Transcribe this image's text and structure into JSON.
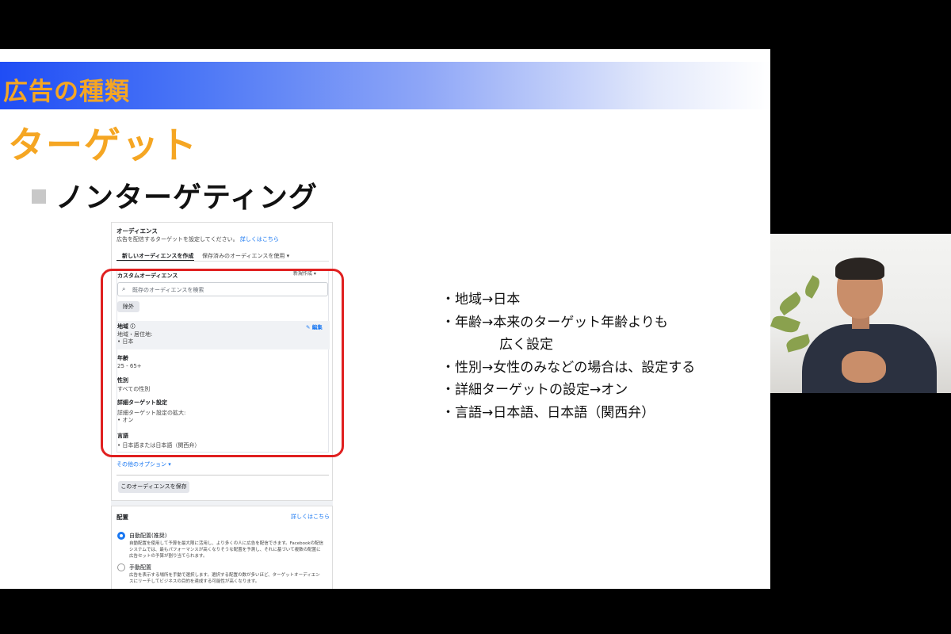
{
  "slide": {
    "band_title": "広告の種類",
    "heading": "ターゲット",
    "subheading": "ノンターゲティング",
    "notes": [
      "・地域→日本",
      "・年齢→本来のターゲット年齢よりも",
      "広く設定",
      "・性別→女性のみなどの場合は、設定する",
      "・詳細ターゲットの設定→オン",
      "・言語→日本語、日本語（関西弁）"
    ]
  },
  "screenshot": {
    "audience_title": "オーディエンス",
    "audience_desc": "広告を配信するターゲットを設定してください。",
    "learn_more": "詳しくはこちら",
    "tab_new": "新しいオーディエンスを作成",
    "tab_saved": "保存済みのオーディエンスを使用 ▾",
    "custom_audience": "カスタムオーディエンス",
    "create_new": "新規作成 ▾",
    "search_placeholder": "既存のオーディエンスを検索",
    "exclude": "除外",
    "region_label": "地域",
    "edit": "編集",
    "region_sub": "地域・居住地:",
    "region_value": "•  日本",
    "age_label": "年齢",
    "age_value": "25 - 65+",
    "gender_label": "性別",
    "gender_value": "すべての性別",
    "detail_label": "詳細ターゲット設定",
    "detail_sub": "詳細ターゲット設定の拡大:",
    "detail_value": "•  オン",
    "lang_label": "言語",
    "lang_value": "•  日本語または日本語（関西弁）",
    "other_options": "その他のオプション ▾",
    "save_audience": "このオーディエンスを保存",
    "placement_title": "配置",
    "placement_learn": "詳しくはこちら",
    "auto_label": "自動配置(推奨)",
    "auto_desc_1": "自動配置を使用して予算を最大限に活用し、より多くの人に広告を配信できます。Facebookの配信",
    "auto_desc_2": "システムでは、最もパフォーマンスが高くなりそうな配置を予測し、それに基づいて複数の配置に",
    "auto_desc_3": "広告セットの予算が割り当てられます。",
    "manual_label": "手動配置",
    "manual_desc_1": "広告を表示する場所を手動で選択します。選択する配置の数が多いほど、ターゲットオーディエン",
    "manual_desc_2": "スにリーチしてビジネスの目的を達成する可能性が高くなります。"
  },
  "colors": {
    "accent_orange": "#f5a623",
    "band_blue": "#1f4df5",
    "highlight_red": "#e02020",
    "link_blue": "#1877f2"
  }
}
